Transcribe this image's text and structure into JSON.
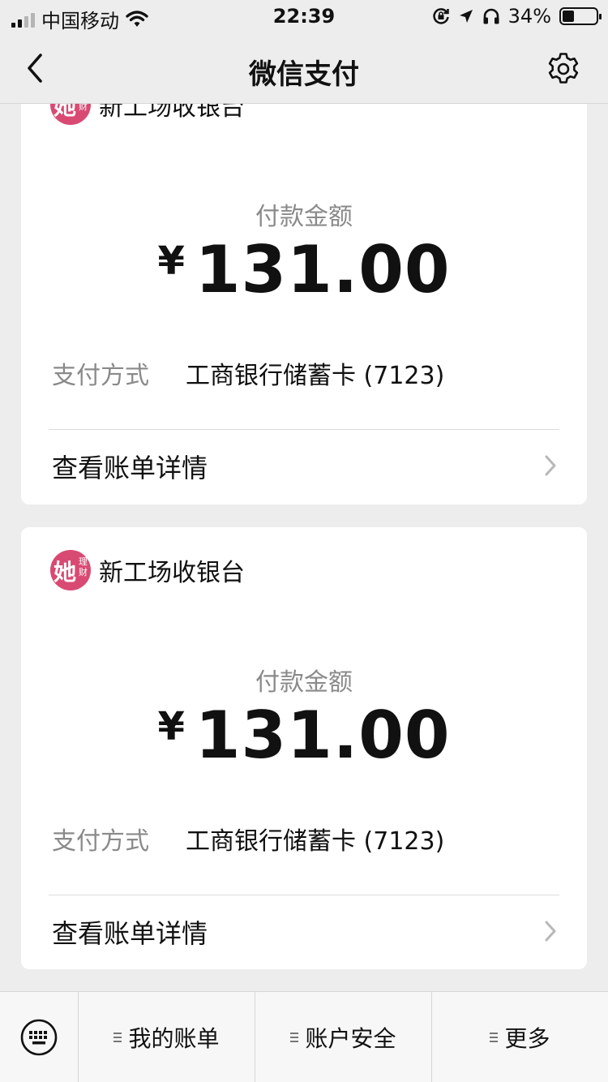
{
  "status_bar": {
    "carrier": "中国移动",
    "time": "22:39",
    "battery": "34%",
    "battery_level": 0.34,
    "icons": [
      "signal-icon",
      "wifi-icon",
      "orientation-lock-icon",
      "location-icon",
      "headphones-icon",
      "battery-icon"
    ]
  },
  "nav": {
    "title": "微信支付",
    "back_icon": "chevron-left-icon",
    "settings_icon": "gear-icon"
  },
  "payments": [
    {
      "merchant": "新工场收银台",
      "logo_text": "她",
      "logo_sub": "理财",
      "amount_label": "付款金额",
      "currency": "¥",
      "amount": "131.00",
      "method_label": "支付方式",
      "method_value": "工商银行储蓄卡 (7123)",
      "detail_label": "查看账单详情"
    },
    {
      "merchant": "新工场收银台",
      "logo_text": "她",
      "logo_sub": "理财",
      "amount_label": "付款金额",
      "currency": "¥",
      "amount": "131.00",
      "method_label": "支付方式",
      "method_value": "工商银行储蓄卡 (7123)",
      "detail_label": "查看账单详情"
    }
  ],
  "bottom_menu": {
    "keyboard_icon": "keyboard-icon",
    "items": [
      {
        "label": "我的账单"
      },
      {
        "label": "账户安全"
      },
      {
        "label": "更多"
      }
    ]
  },
  "colors": {
    "background": "#ededed",
    "card": "#ffffff",
    "logo": "#d94a73",
    "secondary_text": "#8a8a8a"
  }
}
